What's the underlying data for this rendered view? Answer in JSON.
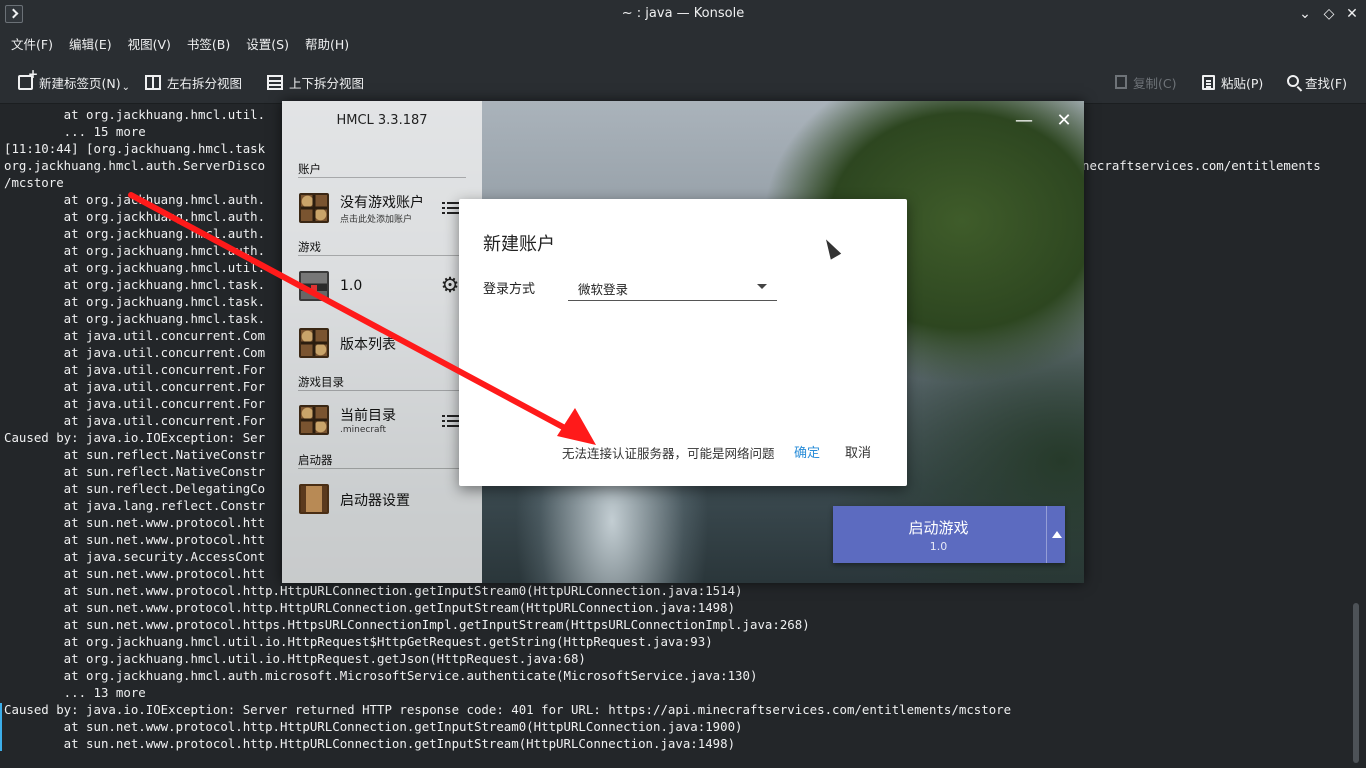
{
  "window": {
    "title": "~ : java — Konsole",
    "buttons": {
      "minimize": "⌄",
      "maximize": "◇",
      "close": "✕"
    }
  },
  "menu": [
    "文件(F)",
    "编辑(E)",
    "视图(V)",
    "书签(B)",
    "设置(S)",
    "帮助(H)"
  ],
  "toolbar": {
    "new_tab": "新建标签页(N)",
    "new_tab_caret": "⌄",
    "split_lr": "左右拆分视图",
    "split_tb": "上下拆分视图",
    "copy": "复制(C)",
    "paste": "粘贴(P)",
    "find": "查找(F)"
  },
  "terminal": {
    "line_first": "        at org.jackhuang.hmcl.util.",
    "lines": [
      "        ... 15 more",
      "[11:10:44] [org.jackhuang.hmcl.task",
      "org.jackhuang.hmcl.auth.ServerDisco",
      "/mcstore",
      "        at org.jackhuang.hmcl.auth.",
      "        at org.jackhuang.hmcl.auth.",
      "        at org.jackhuang.hmcl.auth.",
      "        at org.jackhuang.hmcl.auth.",
      "        at org.jackhuang.hmcl.util.",
      "        at org.jackhuang.hmcl.task.",
      "        at org.jackhuang.hmcl.task.",
      "        at org.jackhuang.hmcl.task.",
      "        at java.util.concurrent.Com",
      "        at java.util.concurrent.Com",
      "        at java.util.concurrent.For",
      "        at java.util.concurrent.For",
      "        at java.util.concurrent.For",
      "        at java.util.concurrent.For",
      "Caused by: java.io.IOException: Ser",
      "        at sun.reflect.NativeConstr",
      "        at sun.reflect.NativeConstr",
      "        at sun.reflect.DelegatingCo",
      "        at java.lang.reflect.Constr",
      "        at sun.net.www.protocol.htt",
      "        at sun.net.www.protocol.htt",
      "        at java.security.AccessCont",
      "        at sun.net.www.protocol.htt",
      "        at sun.net.www.protocol.http.HttpURLConnection.getInputStream0(HttpURLConnection.java:1514)",
      "        at sun.net.www.protocol.http.HttpURLConnection.getInputStream(HttpURLConnection.java:1498)",
      "        at sun.net.www.protocol.https.HttpsURLConnectionImpl.getInputStream(HttpsURLConnectionImpl.java:268)",
      "        at org.jackhuang.hmcl.util.io.HttpRequest$HttpGetRequest.getString(HttpRequest.java:93)",
      "        at org.jackhuang.hmcl.util.io.HttpRequest.getJson(HttpRequest.java:68)",
      "        at org.jackhuang.hmcl.auth.microsoft.MicrosoftService.authenticate(MicrosoftService.java:130)",
      "        ... 13 more",
      "Caused by: java.io.IOException: Server returned HTTP response code: 401 for URL: https://api.minecraftservices.com/entitlements/mcstore",
      "        at sun.net.www.protocol.http.HttpURLConnection.getInputStream0(HttpURLConnection.java:1900)",
      "        at sun.net.www.protocol.http.HttpURLConnection.getInputStream(HttpURLConnection.java:1498)"
    ],
    "overflow_right": "necraftservices.com/entitlements"
  },
  "hmcl": {
    "version": "HMCL 3.3.187",
    "sections": {
      "account": "账户",
      "game": "游戏",
      "game_dir": "游戏目录",
      "launcher": "启动器"
    },
    "account_title": "没有游戏账户",
    "account_sub": "点击此处添加账户",
    "game_version": "1.0",
    "version_list": "版本列表",
    "current_dir": "当前目录",
    "current_dir_sub": ".minecraft",
    "launcher_settings": "启动器设置",
    "minimize": "—",
    "close": "✕"
  },
  "dialog": {
    "title": "新建账户",
    "login_label": "登录方式",
    "login_value": "微软登录",
    "error": "无法连接认证服务器，可能是网络问题",
    "ok": "确定",
    "cancel": "取消"
  },
  "launch": {
    "label": "启动游戏",
    "version": "1.0"
  },
  "colors": {
    "terminal_bg": "#232629",
    "accent": "#5c6bc0",
    "link": "#2a8dd8",
    "arrow": "#ff1a1a"
  }
}
